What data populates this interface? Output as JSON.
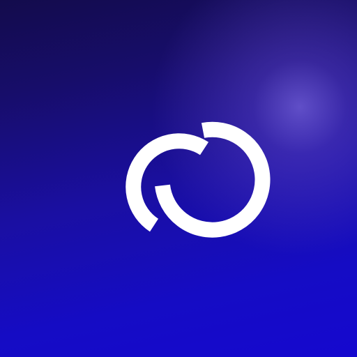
{
  "app_icon": {
    "icon_name": "linked-rings-logo-icon",
    "colors": {
      "background_top": "#130c4c",
      "background_bottom": "#1508cf",
      "highlight": "#6a55c8",
      "mark": "#ffffff"
    }
  }
}
